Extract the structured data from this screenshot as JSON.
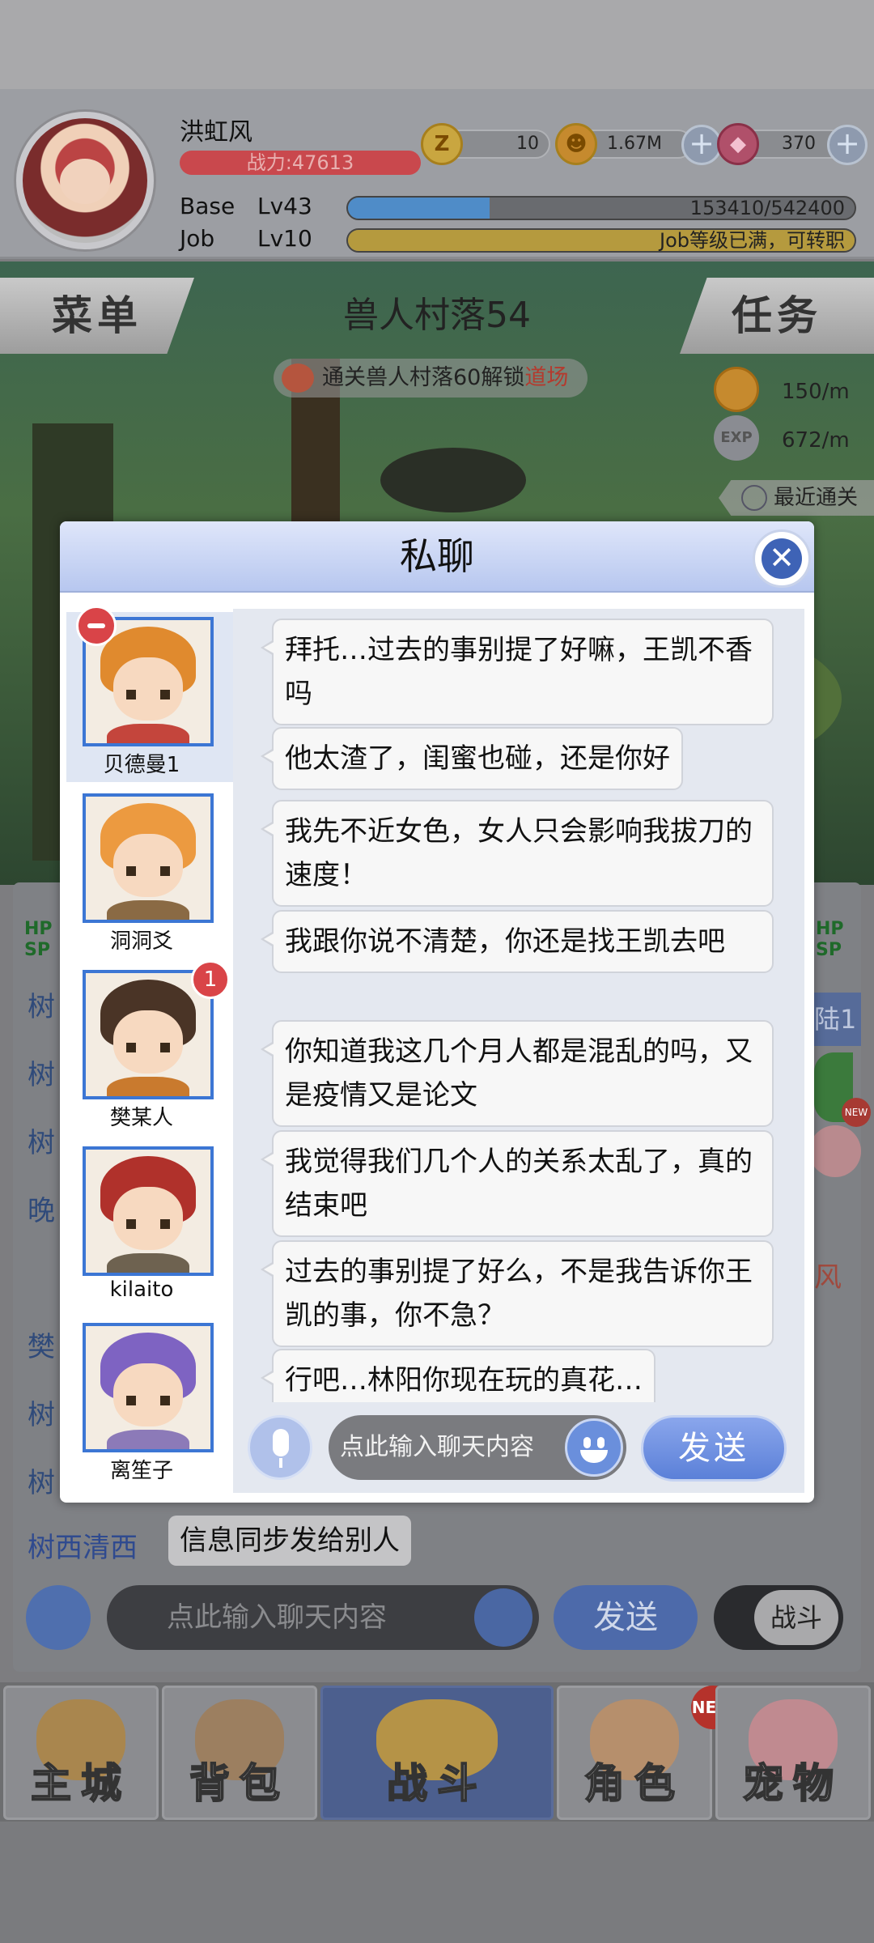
{
  "player": {
    "name": "洪虹风",
    "power": "战力:47613",
    "base_label": "Base",
    "base_level": "Lv43",
    "base_exp_text": "153410/542400",
    "base_exp_progress": 0.28,
    "job_label": "Job",
    "job_level": "Lv10",
    "job_exp_text": "Job等级已满，可转职",
    "job_exp_progress": 1.0
  },
  "currency": [
    {
      "icon": "zeny-token-icon",
      "value": "10"
    },
    {
      "icon": "gold-coin-icon",
      "value": "1.67M"
    },
    {
      "icon": "pink-gem-icon",
      "value": "370"
    }
  ],
  "scene": {
    "menu_label": "菜单",
    "task_label": "任务",
    "map_name": "兽人村落54",
    "unlock_prefix": "通关兽人村落60解锁",
    "unlock_highlight": "道场",
    "gold_rate": "150/m",
    "exp_rate": "672/m",
    "exp_icon_label": "EXP",
    "recent_clear": "最近通关"
  },
  "modal": {
    "title": "私聊",
    "contacts": [
      {
        "name": "贝德曼1",
        "selected": true,
        "badge": "remove"
      },
      {
        "name": "洞洞爻",
        "selected": false
      },
      {
        "name": "樊某人",
        "selected": false,
        "unread": "1"
      },
      {
        "name": "kilaito",
        "selected": false
      },
      {
        "name": "离笙子",
        "selected": false
      }
    ],
    "messages": [
      "拜托…过去的事别提了好嘛，王凯不香吗",
      "他太渣了，闺蜜也碰，还是你好",
      "我先不近女色，女人只会影响我拔刀的速度！",
      "我跟你说不清楚，你还是找王凯去吧",
      "你知道我这几个月人都是混乱的吗，又是疫情又是论文",
      "我觉得我们几个人的关系太乱了，真的结束吧",
      "过去的事别提了好么，不是我告诉你王凯的事，你不急？",
      "行吧…林阳你现在玩的真花…"
    ],
    "input_placeholder": "点此输入聊天内容",
    "send_label": "发送"
  },
  "background_chat": {
    "hp_label": "HP",
    "sp_label": "SP",
    "channel_names": [
      "树",
      "树",
      "树",
      "晚",
      "樊",
      "树",
      "树"
    ],
    "last_sender": "树西清西",
    "last_message": "信息同步发给别人",
    "input_placeholder": "点此输入聊天内容",
    "send_label": "发送",
    "battle_toggle": "战斗",
    "side_text_1": "陆1",
    "side_text_2": "风",
    "side_new": "NEW"
  },
  "bottom_nav": [
    {
      "label": "主城",
      "active": false
    },
    {
      "label": "背包",
      "active": false
    },
    {
      "label": "战斗",
      "active": true
    },
    {
      "label": "角色",
      "active": false,
      "badge": "NEW"
    },
    {
      "label": "宠物",
      "active": false
    }
  ],
  "colors": {
    "accent_blue": "#5b80d8",
    "power_red": "#c9484d",
    "base_exp": "#4f8cc8",
    "job_exp": "#b59a3e",
    "badge_red": "#d94448"
  }
}
